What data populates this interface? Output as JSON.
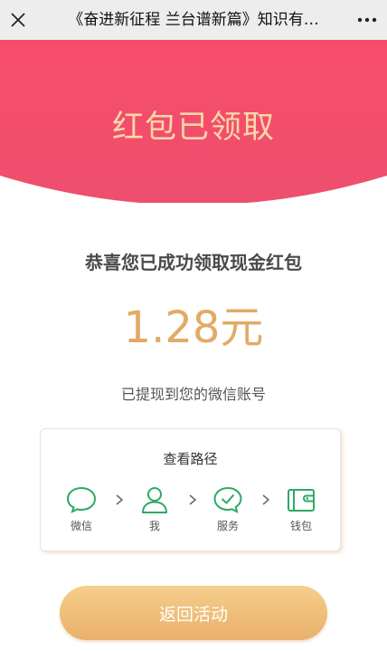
{
  "navbar": {
    "title": "《奋进新征程 兰台谱新篇》知识有…",
    "close_icon": "close-icon",
    "more_icon": "more-icon"
  },
  "hero": {
    "title": "红包已领取",
    "bg_color": "#f2506d"
  },
  "result": {
    "congrats": "恭喜您已成功领取现金红包",
    "amount": "1.28元",
    "note": "已提现到您的微信账号"
  },
  "path": {
    "title": "查看路径",
    "steps": [
      {
        "label": "微信",
        "icon": "chat-bubble-icon"
      },
      {
        "label": "我",
        "icon": "user-icon"
      },
      {
        "label": "服务",
        "icon": "check-circle-icon"
      },
      {
        "label": "钱包",
        "icon": "wallet-icon"
      }
    ],
    "accent_color": "#2daa62"
  },
  "button": {
    "label": "返回活动"
  }
}
